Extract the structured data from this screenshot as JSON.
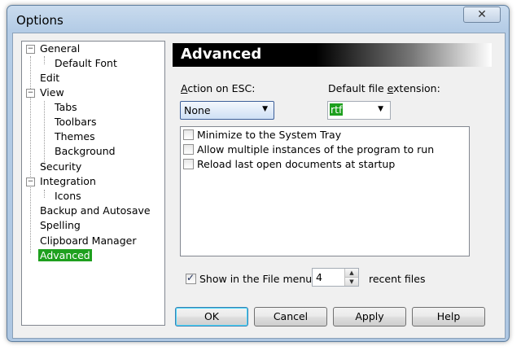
{
  "window": {
    "title": "Options",
    "close_glyph": "✕"
  },
  "tree": {
    "items": [
      {
        "label": "General",
        "expander": "−"
      },
      {
        "label": "Default Font"
      },
      {
        "label": "Edit"
      },
      {
        "label": "View",
        "expander": "−"
      },
      {
        "label": "Tabs"
      },
      {
        "label": "Toolbars"
      },
      {
        "label": "Themes"
      },
      {
        "label": "Background"
      },
      {
        "label": "Security"
      },
      {
        "label": "Integration",
        "expander": "−"
      },
      {
        "label": "Icons"
      },
      {
        "label": "Backup and Autosave"
      },
      {
        "label": "Spelling"
      },
      {
        "label": "Clipboard Manager"
      },
      {
        "label": "Advanced",
        "selected": true
      }
    ]
  },
  "panel": {
    "heading": "Advanced",
    "esc": {
      "label_u": "A",
      "label_rest": "ction on ESC:",
      "value": "None"
    },
    "ext": {
      "label_a": "Default file ",
      "label_u": "e",
      "label_b": "xtension:",
      "value": "rtf"
    },
    "options": [
      {
        "label": "Minimize to the System Tray",
        "checked": false
      },
      {
        "label": "Allow multiple instances of the program to run",
        "checked": false
      },
      {
        "label": "Reload last open documents at startup",
        "checked": false
      }
    ],
    "file_menu": {
      "label": "Show in the File menu",
      "checked": true,
      "count": "4",
      "suffix": "recent files"
    }
  },
  "buttons": {
    "ok": "OK",
    "cancel": "Cancel",
    "apply": "Apply",
    "help": "Help"
  },
  "colors": {
    "selection": "#1ea01e",
    "banner_start": "#000000",
    "banner_end": "#ffffff"
  }
}
